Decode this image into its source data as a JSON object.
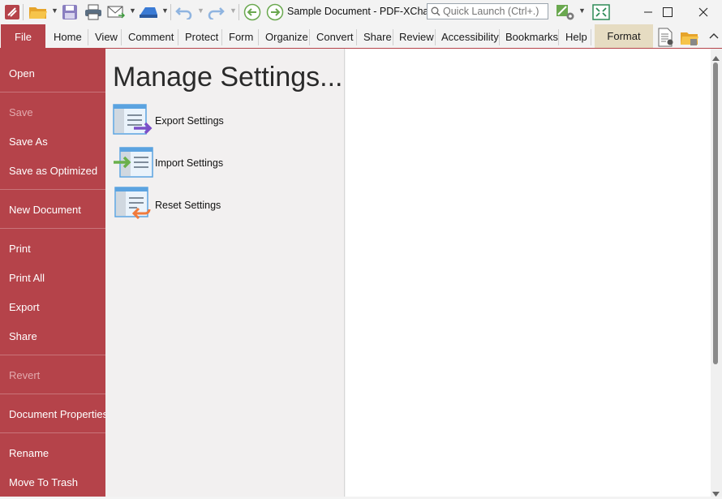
{
  "window": {
    "title": "Sample Document - PDF-XCha...",
    "quick_launch_placeholder": "Quick Launch (Ctrl+.)",
    "controls": [
      "minimize-icon",
      "maximize-icon",
      "close-icon"
    ]
  },
  "toolbar": {
    "icons": [
      "app-icon",
      "open-folder-icon",
      "save-icon",
      "print-icon",
      "email-icon",
      "scan-icon",
      "undo-icon",
      "redo-icon",
      "back-icon",
      "forward-icon",
      "customize-icon",
      "fullscreen-icon"
    ]
  },
  "ribbon": {
    "file_label": "File",
    "tabs": [
      "Home",
      "View",
      "Comment",
      "Protect",
      "Form",
      "Organize",
      "Convert",
      "Share",
      "Review",
      "Accessibility",
      "Bookmarks",
      "Help"
    ],
    "context_tab": "Format"
  },
  "backstage": {
    "items": [
      {
        "label": "Open",
        "enabled": true
      },
      {
        "label": "Save",
        "enabled": false
      },
      {
        "label": "Save As",
        "enabled": true
      },
      {
        "label": "Save as Optimized",
        "enabled": true
      },
      {
        "label": "New Document",
        "enabled": true
      },
      {
        "label": "Print",
        "enabled": true
      },
      {
        "label": "Print All",
        "enabled": true
      },
      {
        "label": "Export",
        "enabled": true
      },
      {
        "label": "Share",
        "enabled": true
      },
      {
        "label": "Revert",
        "enabled": false
      },
      {
        "label": "Document Properties",
        "enabled": true
      },
      {
        "label": "Rename",
        "enabled": true
      },
      {
        "label": "Move To Trash",
        "enabled": true
      }
    ]
  },
  "panel": {
    "heading": "Manage Settings...",
    "options": [
      {
        "label": "Export Settings",
        "icon": "export-settings-icon"
      },
      {
        "label": "Import Settings",
        "icon": "import-settings-icon"
      },
      {
        "label": "Reset Settings",
        "icon": "reset-settings-icon"
      }
    ]
  },
  "colors": {
    "accent": "#b5434a",
    "format_tab": "#e6dcc2"
  }
}
